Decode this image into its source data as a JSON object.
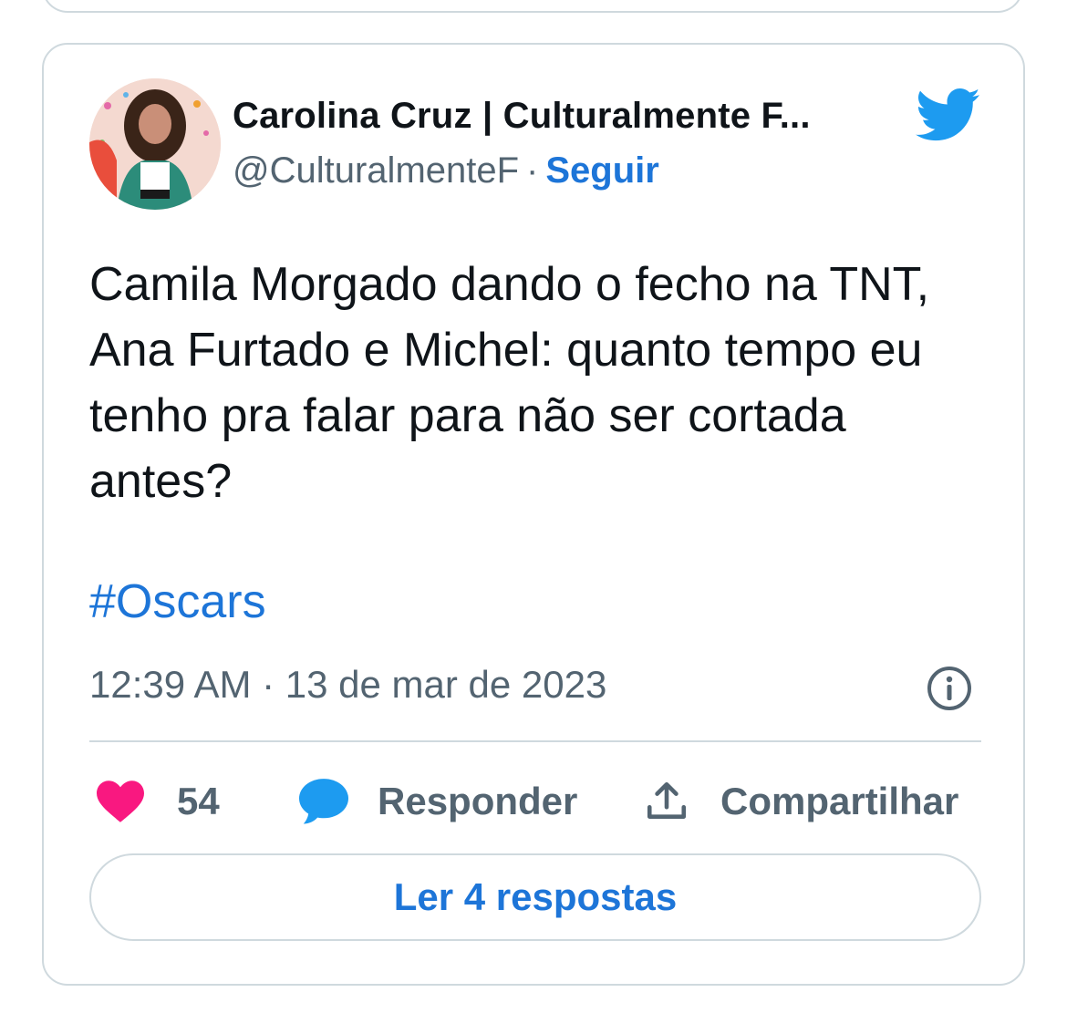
{
  "tweet": {
    "author_name": "Carolina Cruz | Culturalmente F...",
    "handle": "@CulturalmenteF",
    "separator": "·",
    "follow_label": "Seguir",
    "text": "Camila Morgado dando o fecho na TNT, Ana Furtado e Michel: quanto tempo eu tenho pra falar para não ser cortada antes?",
    "hashtag": "#Oscars",
    "timestamp": "12:39 AM · 13 de mar de 2023"
  },
  "actions": {
    "like_count": "54",
    "reply_label": "Responder",
    "share_label": "Compartilhar"
  },
  "read_replies_label": "Ler 4 respostas",
  "icons": {
    "brand": "twitter-bird-icon",
    "info": "info-icon",
    "like": "heart-icon",
    "reply": "speech-bubble-icon",
    "share": "share-upload-icon"
  },
  "colors": {
    "accent": "#1d75d8",
    "twitter_blue": "#1d9bf0",
    "like": "#f91880",
    "text": "#0f1419",
    "muted": "#536471",
    "border": "#cfd9de"
  }
}
